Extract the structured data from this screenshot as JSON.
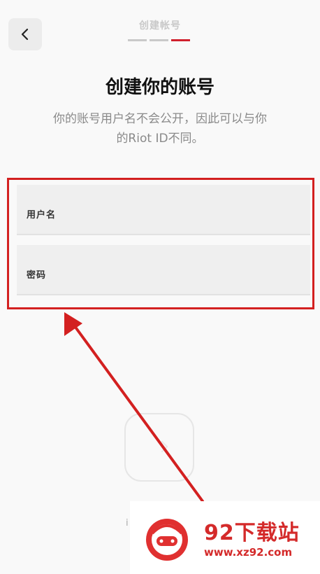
{
  "header": {
    "step_title": "创建帐号",
    "steps_total": 3,
    "steps_active": 3
  },
  "main": {
    "title": "创建你的账号",
    "subtitle_line1": "你的账号用户名不会公开，因此可以与你",
    "subtitle_line2": "的Riot ID不同。"
  },
  "form": {
    "username_label": "用户名",
    "password_label": "密码"
  },
  "footer": {
    "text": "i"
  },
  "watermark": {
    "name": "92下载站",
    "url": "www.xz92.com"
  },
  "colors": {
    "accent": "#d0202d",
    "annotation": "#d32020"
  }
}
